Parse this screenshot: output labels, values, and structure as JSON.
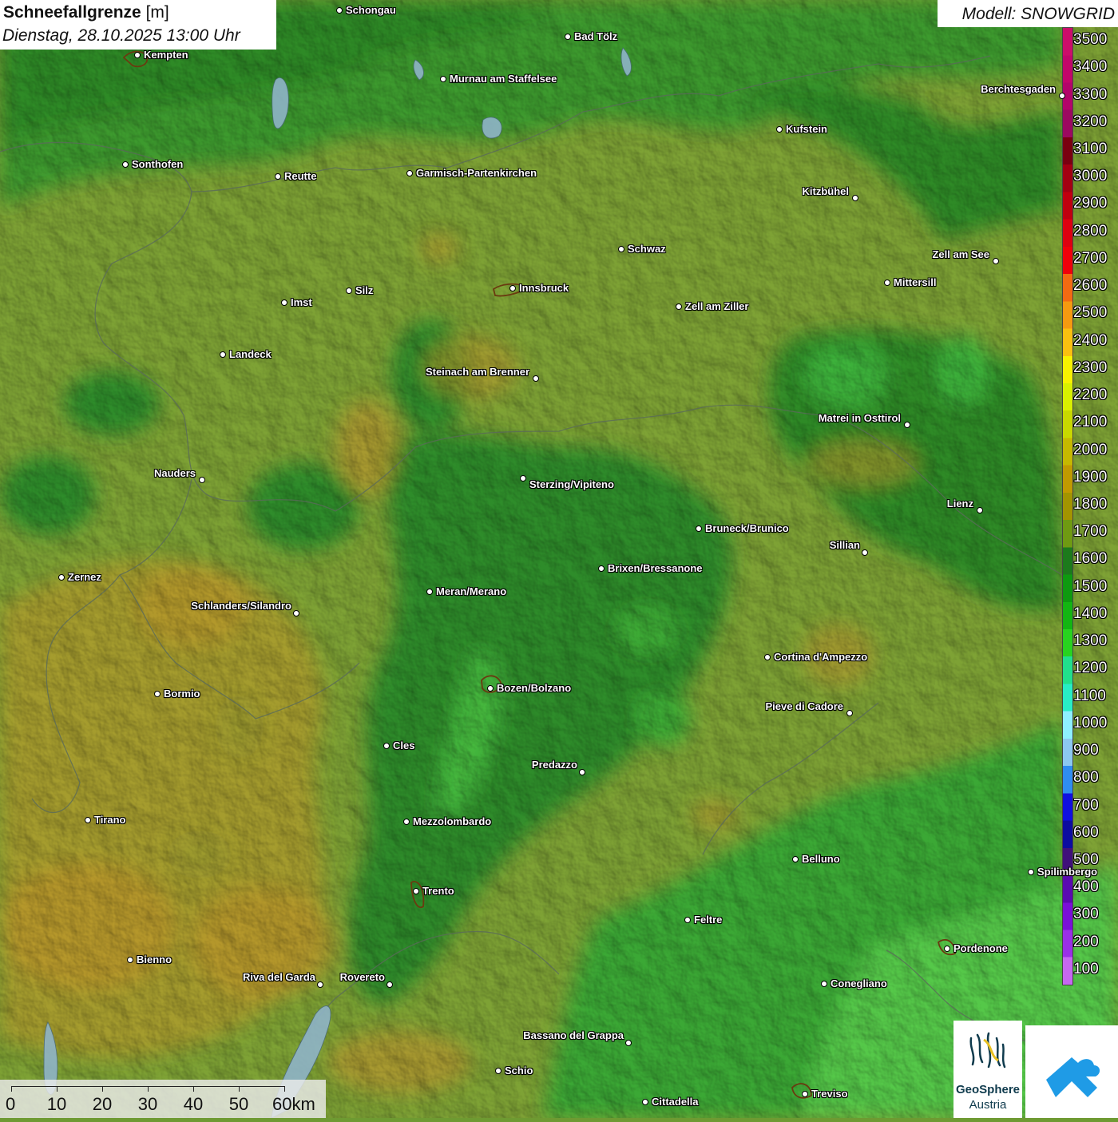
{
  "title": {
    "main": "Schneefallgrenze",
    "unit": "[m]",
    "datetime": "Dienstag, 28.10.2025 13:00 Uhr"
  },
  "model_label": "Modell: SNOWGRID",
  "legend": {
    "labels": [
      "3500",
      "3400",
      "3300",
      "3200",
      "3100",
      "3000",
      "2900",
      "2800",
      "2700",
      "2600",
      "2500",
      "2400",
      "2300",
      "2200",
      "2100",
      "2000",
      "1900",
      "1800",
      "1700",
      "1600",
      "1500",
      "1400",
      "1300",
      "1200",
      "1100",
      "1000",
      "900",
      "800",
      "700",
      "600",
      "500",
      "400",
      "300",
      "200",
      "100"
    ],
    "colors": [
      "#cc0d6a",
      "#c2066a",
      "#b3046a",
      "#9b0960",
      "#7a0010",
      "#a30012",
      "#c0000f",
      "#dd0010",
      "#f0000a",
      "#f26a12",
      "#f59a10",
      "#fac010",
      "#f7f200",
      "#d9f000",
      "#c8d800",
      "#c6b800",
      "#c19a00",
      "#a39400",
      "#6f9a12",
      "#1c7a1c",
      "#0e9a10",
      "#13b512",
      "#28d31f",
      "#21e08c",
      "#28edc5",
      "#8ef0ff",
      "#8cc8f0",
      "#2f8df0",
      "#1010e0",
      "#0c0ca0",
      "#40107a",
      "#5a0ab0",
      "#7a10d8",
      "#9a30e6",
      "#c668f0"
    ]
  },
  "cities": [
    {
      "name": "Schongau"
    },
    {
      "name": "Bad Tölz"
    },
    {
      "name": "Kempten"
    },
    {
      "name": "Murnau am Staffelsee"
    },
    {
      "name": "Kufstein"
    },
    {
      "name": "Sonthofen"
    },
    {
      "name": "Reutte"
    },
    {
      "name": "Garmisch-Partenkirchen"
    },
    {
      "name": "Kitzbühel"
    },
    {
      "name": "Schwaz"
    },
    {
      "name": "Zell am See"
    },
    {
      "name": "Innsbruck"
    },
    {
      "name": "Mittersill"
    },
    {
      "name": "Imst"
    },
    {
      "name": "Silz"
    },
    {
      "name": "Zell am Ziller"
    },
    {
      "name": "Landeck"
    },
    {
      "name": "Steinach am Brenner"
    },
    {
      "name": "Matrei in Osttirol"
    },
    {
      "name": "Nauders"
    },
    {
      "name": "Sterzing/Vipiteno"
    },
    {
      "name": "Lienz"
    },
    {
      "name": "Bruneck/Brunico"
    },
    {
      "name": "Sillian"
    },
    {
      "name": "Zernez"
    },
    {
      "name": "Brixen/Bressanone"
    },
    {
      "name": "Meran/Merano"
    },
    {
      "name": "Schlanders/Silandro"
    },
    {
      "name": "Cortina d'Ampezzo"
    },
    {
      "name": "Bozen/Bolzano"
    },
    {
      "name": "Bormio"
    },
    {
      "name": "Pieve di Cadore"
    },
    {
      "name": "Cles"
    },
    {
      "name": "Predazzo"
    },
    {
      "name": "Tirano"
    },
    {
      "name": "Mezzolombardo"
    },
    {
      "name": "Belluno"
    },
    {
      "name": "Trento"
    },
    {
      "name": "Feltre"
    },
    {
      "name": "Pordenone"
    },
    {
      "name": "Bienno"
    },
    {
      "name": "Riva del Garda"
    },
    {
      "name": "Rovereto"
    },
    {
      "name": "Conegliano"
    },
    {
      "name": "Bassano del Grappa"
    },
    {
      "name": "Schio"
    },
    {
      "name": "Treviso"
    },
    {
      "name": "Cittadella"
    },
    {
      "name": "Berchtesgaden"
    },
    {
      "name": "Spilimbergo"
    }
  ],
  "scale_bar": {
    "labels": [
      "0",
      "10",
      "20",
      "30",
      "40",
      "50",
      "60km"
    ]
  },
  "logos": {
    "geosphere_name": "GeoSphere",
    "geosphere_sub": "Austria"
  }
}
